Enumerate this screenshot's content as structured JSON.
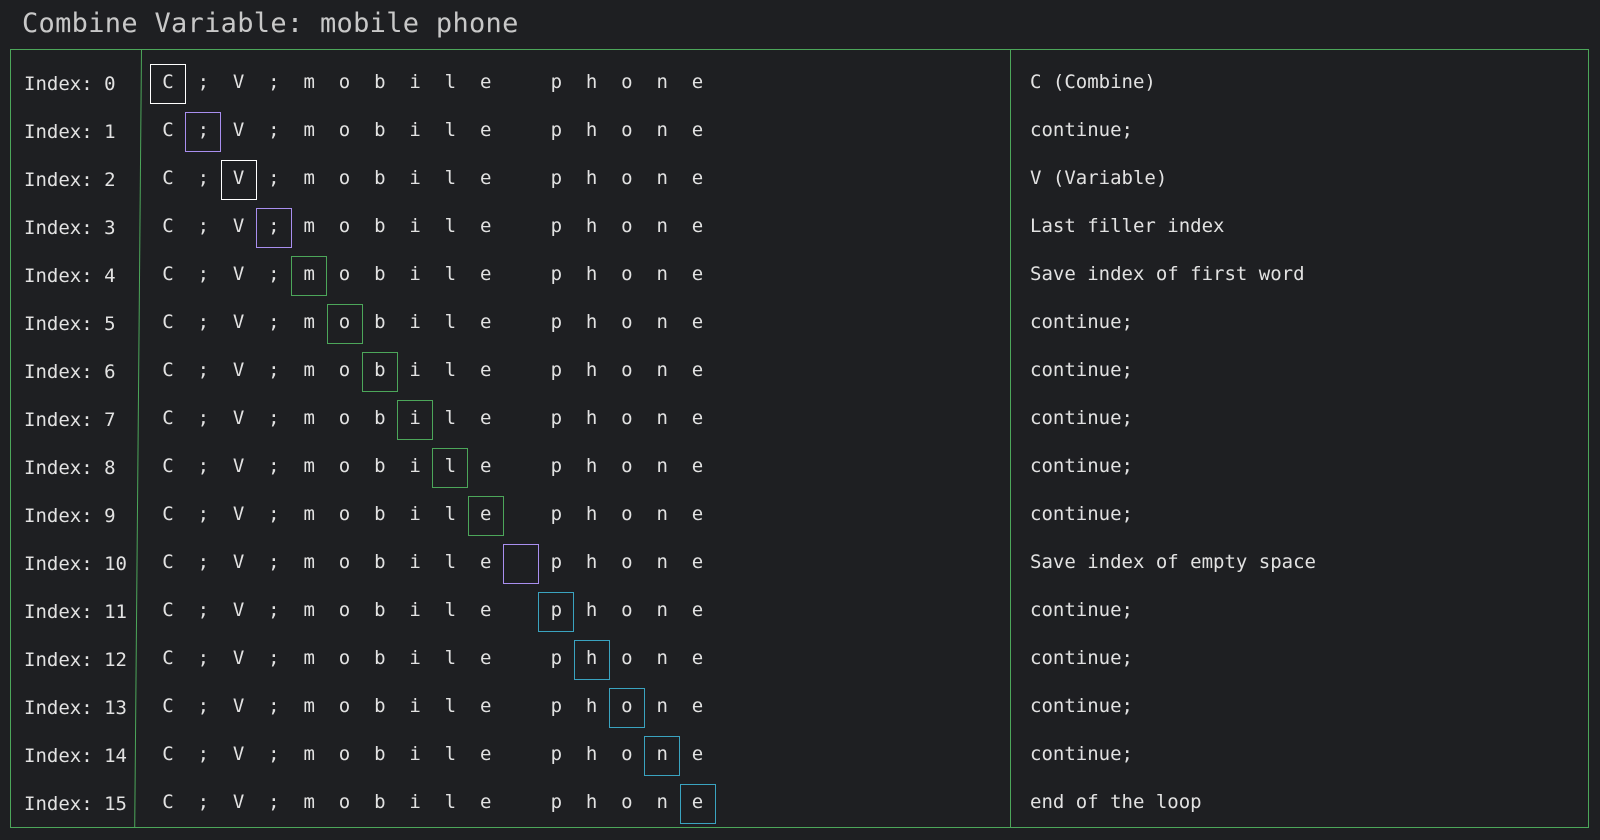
{
  "title": "Combine Variable: mobile phone",
  "chars": [
    "C",
    ";",
    "V",
    ";",
    "m",
    "o",
    "b",
    "i",
    "l",
    "e",
    "",
    "p",
    "h",
    "o",
    "n",
    "e"
  ],
  "colors": {
    "frame": "#4ca65a",
    "white": "#ffffff",
    "purple": "#a98ff0",
    "green": "#4ca65a",
    "cyan": "#3aa3c0"
  },
  "rows": [
    {
      "index_label": "Index: 0",
      "highlight": 0,
      "box_color": "white",
      "comment": "C (Combine)"
    },
    {
      "index_label": "Index: 1",
      "highlight": 1,
      "box_color": "purple",
      "comment": "continue;"
    },
    {
      "index_label": "Index: 2",
      "highlight": 2,
      "box_color": "white",
      "comment": "V (Variable)"
    },
    {
      "index_label": "Index: 3",
      "highlight": 3,
      "box_color": "purple",
      "comment": "Last filler index"
    },
    {
      "index_label": "Index: 4",
      "highlight": 4,
      "box_color": "green",
      "comment": "Save index of first word"
    },
    {
      "index_label": "Index: 5",
      "highlight": 5,
      "box_color": "green",
      "comment": "continue;"
    },
    {
      "index_label": "Index: 6",
      "highlight": 6,
      "box_color": "green",
      "comment": "continue;"
    },
    {
      "index_label": "Index: 7",
      "highlight": 7,
      "box_color": "green",
      "comment": "continue;"
    },
    {
      "index_label": "Index: 8",
      "highlight": 8,
      "box_color": "green",
      "comment": "continue;"
    },
    {
      "index_label": "Index: 9",
      "highlight": 9,
      "box_color": "green",
      "comment": "continue;"
    },
    {
      "index_label": "Index: 10",
      "highlight": 10,
      "box_color": "purple",
      "comment": "Save index of empty space"
    },
    {
      "index_label": "Index: 11",
      "highlight": 11,
      "box_color": "cyan",
      "comment": "continue;"
    },
    {
      "index_label": "Index: 12",
      "highlight": 12,
      "box_color": "cyan",
      "comment": "continue;"
    },
    {
      "index_label": "Index: 13",
      "highlight": 13,
      "box_color": "cyan",
      "comment": "continue;"
    },
    {
      "index_label": "Index: 14",
      "highlight": 14,
      "box_color": "cyan",
      "comment": "continue;"
    },
    {
      "index_label": "Index: 15",
      "highlight": 15,
      "box_color": "cyan",
      "comment": "end of the loop"
    }
  ]
}
